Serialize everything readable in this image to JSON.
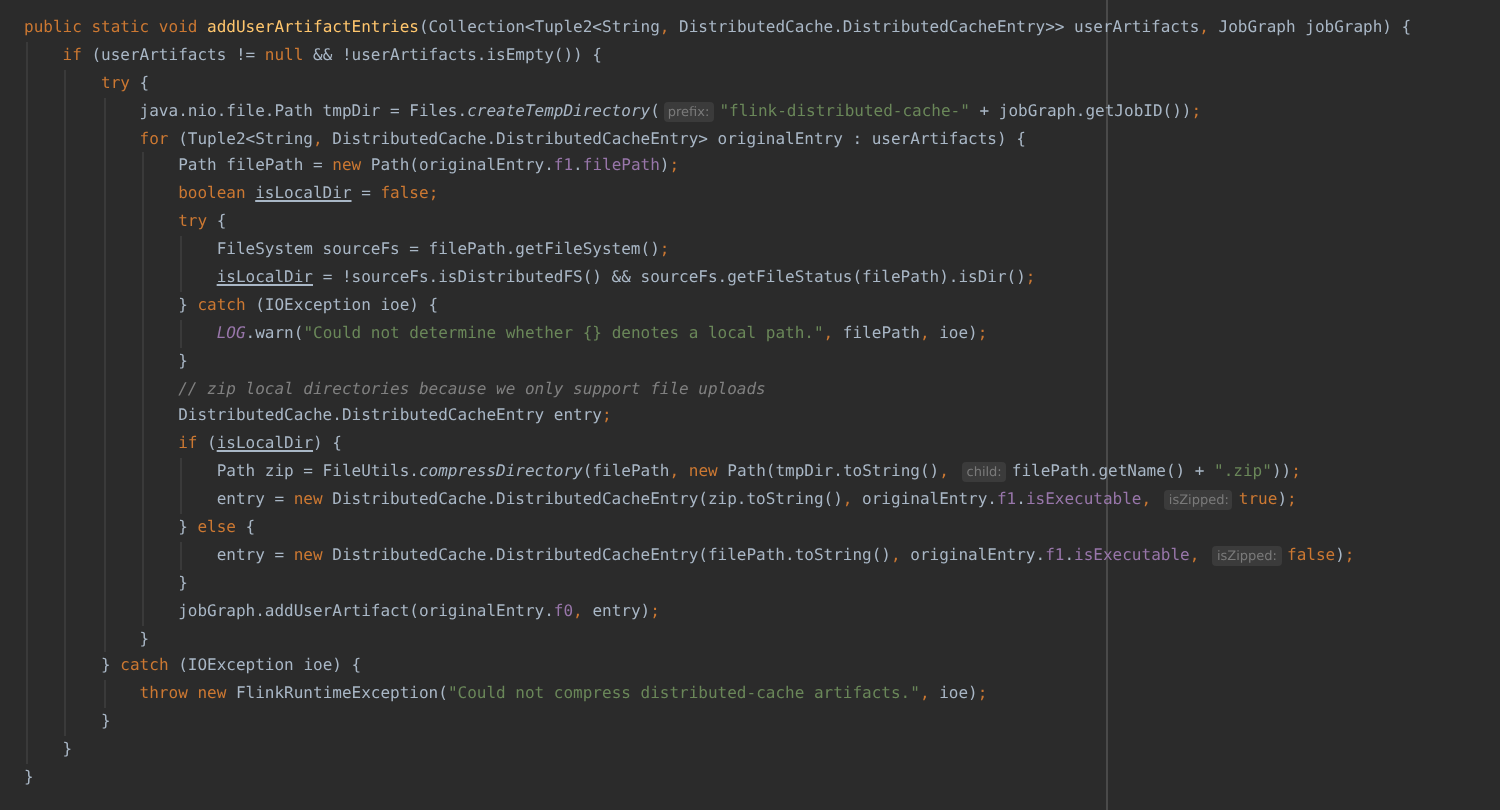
{
  "editor": {
    "lines": [
      {
        "tokens": [
          {
            "kind": "keyword",
            "text": "public static void "
          },
          {
            "kind": "declaration",
            "text": "addUserArtifactEntries"
          },
          {
            "kind": "plain",
            "text": "(Collection<Tuple2<String"
          },
          {
            "kind": "punct",
            "text": ", "
          },
          {
            "kind": "plain",
            "text": "DistributedCache.DistributedCacheEntry>> userArtifacts"
          },
          {
            "kind": "punct",
            "text": ", "
          },
          {
            "kind": "plain",
            "text": "JobGraph jobGraph) {"
          }
        ],
        "children": [
          {
            "tokens": [
              {
                "kind": "keyword",
                "text": "if "
              },
              {
                "kind": "plain",
                "text": "(userArtifacts != "
              },
              {
                "kind": "keyword",
                "text": "null"
              },
              {
                "kind": "plain",
                "text": " && !userArtifacts.isEmpty()) {"
              }
            ],
            "children": [
              {
                "tokens": [
                  {
                    "kind": "keyword",
                    "text": "try "
                  },
                  {
                    "kind": "plain",
                    "text": "{"
                  }
                ],
                "children": [
                  {
                    "tokens": [
                      {
                        "kind": "plain",
                        "text": "java.nio.file.Path tmpDir = Files."
                      },
                      {
                        "kind": "static",
                        "text": "createTempDirectory"
                      },
                      {
                        "kind": "plain",
                        "text": "("
                      },
                      {
                        "kind": "hint",
                        "text": "prefix:"
                      },
                      {
                        "kind": "string",
                        "text": "\"flink-distributed-cache-\""
                      },
                      {
                        "kind": "plain",
                        "text": " + jobGraph.getJobID())"
                      },
                      {
                        "kind": "punct",
                        "text": ";"
                      }
                    ]
                  },
                  {
                    "tokens": [
                      {
                        "kind": "keyword",
                        "text": "for "
                      },
                      {
                        "kind": "plain",
                        "text": "(Tuple2<String"
                      },
                      {
                        "kind": "punct",
                        "text": ", "
                      },
                      {
                        "kind": "plain",
                        "text": "DistributedCache.DistributedCacheEntry> originalEntry : userArtifacts) {"
                      }
                    ],
                    "children": [
                      {
                        "tokens": [
                          {
                            "kind": "plain",
                            "text": "Path filePath = "
                          },
                          {
                            "kind": "keyword",
                            "text": "new "
                          },
                          {
                            "kind": "plain",
                            "text": "Path(originalEntry."
                          },
                          {
                            "kind": "field",
                            "text": "f1"
                          },
                          {
                            "kind": "plain",
                            "text": "."
                          },
                          {
                            "kind": "field",
                            "text": "filePath"
                          },
                          {
                            "kind": "plain",
                            "text": ")"
                          },
                          {
                            "kind": "punct",
                            "text": ";"
                          }
                        ]
                      },
                      {
                        "tokens": [
                          {
                            "kind": "keyword",
                            "text": "boolean "
                          },
                          {
                            "kind": "variable",
                            "text": "isLocalDir"
                          },
                          {
                            "kind": "plain",
                            "text": " = "
                          },
                          {
                            "kind": "keyword",
                            "text": "false"
                          },
                          {
                            "kind": "punct",
                            "text": ";"
                          }
                        ]
                      },
                      {
                        "tokens": [
                          {
                            "kind": "keyword",
                            "text": "try "
                          },
                          {
                            "kind": "plain",
                            "text": "{"
                          }
                        ],
                        "children": [
                          {
                            "tokens": [
                              {
                                "kind": "plain",
                                "text": "FileSystem sourceFs = filePath.getFileSystem()"
                              },
                              {
                                "kind": "punct",
                                "text": ";"
                              }
                            ]
                          },
                          {
                            "tokens": [
                              {
                                "kind": "variable",
                                "text": "isLocalDir"
                              },
                              {
                                "kind": "plain",
                                "text": " = !sourceFs.isDistributedFS() && sourceFs.getFileStatus(filePath).isDir()"
                              },
                              {
                                "kind": "punct",
                                "text": ";"
                              }
                            ]
                          }
                        ]
                      },
                      {
                        "tokens": [
                          {
                            "kind": "plain",
                            "text": "} "
                          },
                          {
                            "kind": "keyword",
                            "text": "catch "
                          },
                          {
                            "kind": "plain",
                            "text": "(IOException ioe) {"
                          }
                        ],
                        "children": [
                          {
                            "tokens": [
                              {
                                "kind": "staticfield",
                                "text": "LOG"
                              },
                              {
                                "kind": "plain",
                                "text": ".warn("
                              },
                              {
                                "kind": "string",
                                "text": "\"Could not determine whether {} denotes a local path.\""
                              },
                              {
                                "kind": "punct",
                                "text": ", "
                              },
                              {
                                "kind": "plain",
                                "text": "filePath"
                              },
                              {
                                "kind": "punct",
                                "text": ", "
                              },
                              {
                                "kind": "plain",
                                "text": "ioe)"
                              },
                              {
                                "kind": "punct",
                                "text": ";"
                              }
                            ]
                          }
                        ]
                      },
                      {
                        "tokens": [
                          {
                            "kind": "plain",
                            "text": "}"
                          }
                        ]
                      },
                      {
                        "tokens": [
                          {
                            "kind": "comment",
                            "text": "// zip local directories because we only support file uploads"
                          }
                        ]
                      },
                      {
                        "tokens": [
                          {
                            "kind": "plain",
                            "text": "DistributedCache.DistributedCacheEntry entry"
                          },
                          {
                            "kind": "punct",
                            "text": ";"
                          }
                        ]
                      },
                      {
                        "tokens": [
                          {
                            "kind": "keyword",
                            "text": "if "
                          },
                          {
                            "kind": "plain",
                            "text": "("
                          },
                          {
                            "kind": "variable",
                            "text": "isLocalDir"
                          },
                          {
                            "kind": "plain",
                            "text": ") {"
                          }
                        ],
                        "children": [
                          {
                            "tokens": [
                              {
                                "kind": "plain",
                                "text": "Path zip = FileUtils."
                              },
                              {
                                "kind": "static",
                                "text": "compressDirectory"
                              },
                              {
                                "kind": "plain",
                                "text": "(filePath"
                              },
                              {
                                "kind": "punct",
                                "text": ", "
                              },
                              {
                                "kind": "keyword",
                                "text": "new "
                              },
                              {
                                "kind": "plain",
                                "text": "Path(tmpDir.toString()"
                              },
                              {
                                "kind": "punct",
                                "text": ", "
                              },
                              {
                                "kind": "hint",
                                "text": "child:"
                              },
                              {
                                "kind": "plain",
                                "text": "filePath.getName() + "
                              },
                              {
                                "kind": "string",
                                "text": "\".zip\""
                              },
                              {
                                "kind": "plain",
                                "text": "))"
                              },
                              {
                                "kind": "punct",
                                "text": ";"
                              }
                            ]
                          },
                          {
                            "tokens": [
                              {
                                "kind": "plain",
                                "text": "entry = "
                              },
                              {
                                "kind": "keyword",
                                "text": "new "
                              },
                              {
                                "kind": "plain",
                                "text": "DistributedCache.DistributedCacheEntry(zip.toString()"
                              },
                              {
                                "kind": "punct",
                                "text": ", "
                              },
                              {
                                "kind": "plain",
                                "text": "originalEntry."
                              },
                              {
                                "kind": "field",
                                "text": "f1"
                              },
                              {
                                "kind": "plain",
                                "text": "."
                              },
                              {
                                "kind": "field",
                                "text": "isExecutable"
                              },
                              {
                                "kind": "punct",
                                "text": ", "
                              },
                              {
                                "kind": "hint",
                                "text": "isZipped:"
                              },
                              {
                                "kind": "keyword",
                                "text": "true"
                              },
                              {
                                "kind": "plain",
                                "text": ")"
                              },
                              {
                                "kind": "punct",
                                "text": ";"
                              }
                            ]
                          }
                        ]
                      },
                      {
                        "tokens": [
                          {
                            "kind": "plain",
                            "text": "} "
                          },
                          {
                            "kind": "keyword",
                            "text": "else "
                          },
                          {
                            "kind": "plain",
                            "text": "{"
                          }
                        ],
                        "children": [
                          {
                            "tokens": [
                              {
                                "kind": "plain",
                                "text": "entry = "
                              },
                              {
                                "kind": "keyword",
                                "text": "new "
                              },
                              {
                                "kind": "plain",
                                "text": "DistributedCache.DistributedCacheEntry(filePath.toString()"
                              },
                              {
                                "kind": "punct",
                                "text": ", "
                              },
                              {
                                "kind": "plain",
                                "text": "originalEntry."
                              },
                              {
                                "kind": "field",
                                "text": "f1"
                              },
                              {
                                "kind": "plain",
                                "text": "."
                              },
                              {
                                "kind": "field",
                                "text": "isExecutable"
                              },
                              {
                                "kind": "punct",
                                "text": ", "
                              },
                              {
                                "kind": "hint",
                                "text": "isZipped:"
                              },
                              {
                                "kind": "keyword",
                                "text": "false"
                              },
                              {
                                "kind": "plain",
                                "text": ")"
                              },
                              {
                                "kind": "punct",
                                "text": ";"
                              }
                            ]
                          }
                        ]
                      },
                      {
                        "tokens": [
                          {
                            "kind": "plain",
                            "text": "}"
                          }
                        ]
                      },
                      {
                        "tokens": [
                          {
                            "kind": "plain",
                            "text": "jobGraph.addUserArtifact(originalEntry."
                          },
                          {
                            "kind": "field",
                            "text": "f0"
                          },
                          {
                            "kind": "punct",
                            "text": ", "
                          },
                          {
                            "kind": "plain",
                            "text": "entry)"
                          },
                          {
                            "kind": "punct",
                            "text": ";"
                          }
                        ]
                      }
                    ]
                  },
                  {
                    "tokens": [
                      {
                        "kind": "plain",
                        "text": "}"
                      }
                    ]
                  }
                ]
              },
              {
                "tokens": [
                  {
                    "kind": "plain",
                    "text": "} "
                  },
                  {
                    "kind": "keyword",
                    "text": "catch "
                  },
                  {
                    "kind": "plain",
                    "text": "(IOException ioe) {"
                  }
                ],
                "children": [
                  {
                    "tokens": [
                      {
                        "kind": "keyword",
                        "text": "throw new "
                      },
                      {
                        "kind": "plain",
                        "text": "FlinkRuntimeException("
                      },
                      {
                        "kind": "string",
                        "text": "\"Could not compress distributed-cache artifacts.\""
                      },
                      {
                        "kind": "punct",
                        "text": ", "
                      },
                      {
                        "kind": "plain",
                        "text": "ioe)"
                      },
                      {
                        "kind": "punct",
                        "text": ";"
                      }
                    ]
                  }
                ]
              },
              {
                "tokens": [
                  {
                    "kind": "plain",
                    "text": "}"
                  }
                ]
              }
            ]
          },
          {
            "tokens": [
              {
                "kind": "plain",
                "text": "}"
              }
            ]
          }
        ]
      },
      {
        "tokens": [
          {
            "kind": "plain",
            "text": "}"
          }
        ]
      }
    ]
  }
}
